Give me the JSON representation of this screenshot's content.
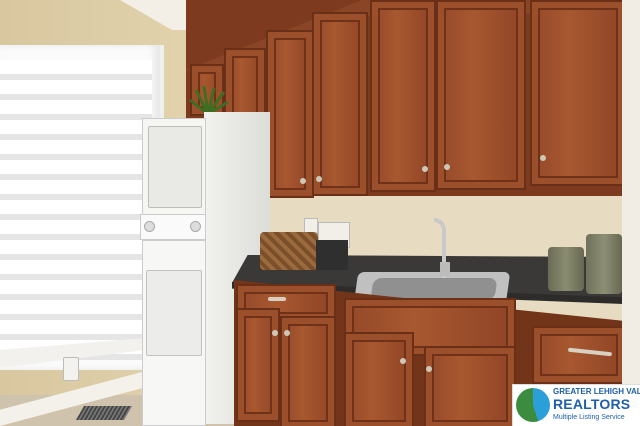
{
  "scene": {
    "description_colors": {
      "cabinet_wood": "#8f4426",
      "wall": "#e7dcc2",
      "countertop": "#3a3937",
      "appliance_white": "#f5f5f2"
    }
  },
  "watermark": {
    "line1": "GREATER",
    "line2": "LEHIGH VALLEY",
    "line3": "REALTORS",
    "line4": "Multiple Listing Service",
    "brand_blue": "#1e5fa8",
    "logo_icon": "gv-realtors-logo-icon"
  }
}
